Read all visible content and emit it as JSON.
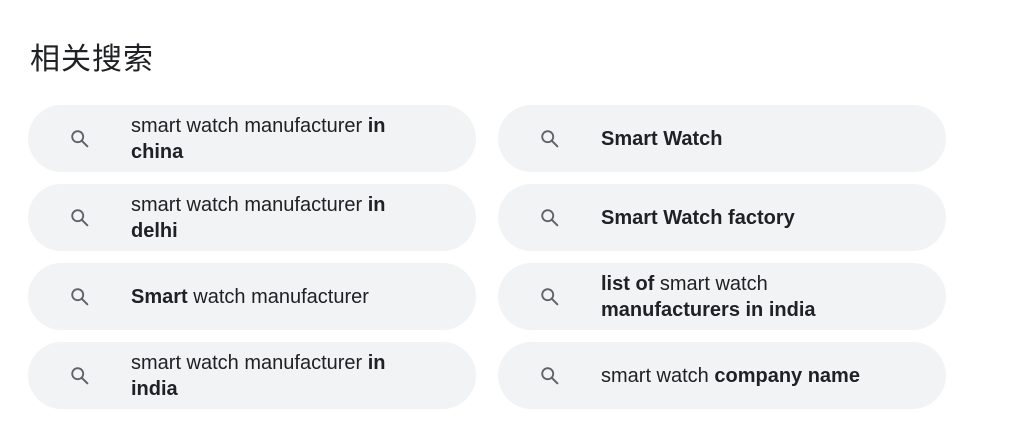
{
  "section": {
    "title": "相关搜索"
  },
  "related_searches": [
    {
      "parts": [
        {
          "text": "smart watch manufacturer ",
          "bold": false
        },
        {
          "text": "in china",
          "bold": true
        }
      ]
    },
    {
      "parts": [
        {
          "text": "Smart Watch",
          "bold": true
        }
      ]
    },
    {
      "parts": [
        {
          "text": "smart watch manufacturer ",
          "bold": false
        },
        {
          "text": "in delhi",
          "bold": true
        }
      ]
    },
    {
      "parts": [
        {
          "text": "Smart Watch factory",
          "bold": true
        }
      ]
    },
    {
      "parts": [
        {
          "text": "Smart",
          "bold": true
        },
        {
          "text": " watch manufacturer",
          "bold": false
        }
      ]
    },
    {
      "parts": [
        {
          "text": "list of",
          "bold": true
        },
        {
          "text": " smart watch ",
          "bold": false
        },
        {
          "text": "manufacturers in india",
          "bold": true
        }
      ]
    },
    {
      "parts": [
        {
          "text": "smart watch manufacturer ",
          "bold": false
        },
        {
          "text": "in india",
          "bold": true
        }
      ]
    },
    {
      "parts": [
        {
          "text": "smart watch ",
          "bold": false
        },
        {
          "text": "company name",
          "bold": true
        }
      ]
    }
  ],
  "icons": {
    "chip_icon": "search-icon",
    "icon_color": "#5f6368"
  },
  "colors": {
    "chip_background": "#f1f3f4",
    "text": "#202124"
  }
}
